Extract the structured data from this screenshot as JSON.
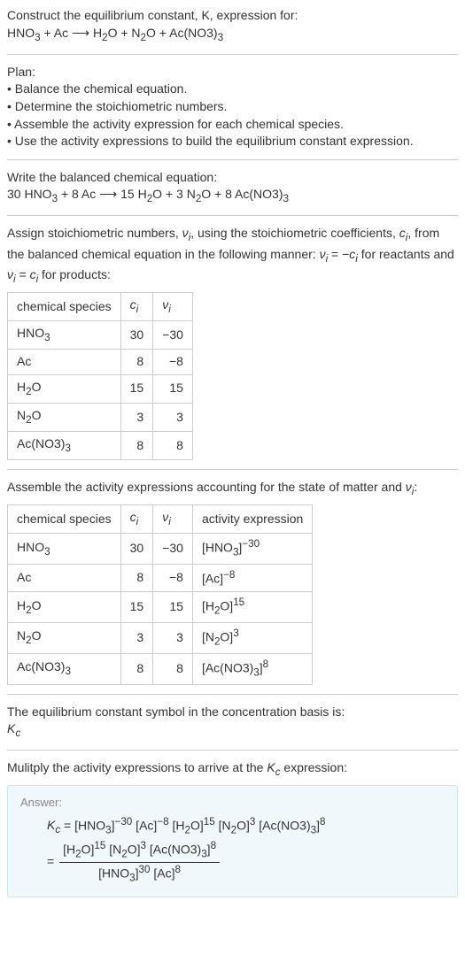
{
  "header": {
    "prompt_line1": "Construct the equilibrium constant, K, expression for:",
    "prompt_line2_html": "HNO<sub>3</sub> + Ac ⟶ H<sub>2</sub>O + N<sub>2</sub>O + Ac(NO3)<sub>3</sub>"
  },
  "plan": {
    "title": "Plan:",
    "items": [
      "• Balance the chemical equation.",
      "• Determine the stoichiometric numbers.",
      "• Assemble the activity expression for each chemical species.",
      "• Use the activity expressions to build the equilibrium constant expression."
    ]
  },
  "balanced": {
    "intro": "Write the balanced chemical equation:",
    "equation_html": "30 HNO<sub>3</sub> + 8 Ac ⟶ 15 H<sub>2</sub>O + 3 N<sub>2</sub>O + 8 Ac(NO3)<sub>3</sub>"
  },
  "stoich": {
    "intro_html": "Assign stoichiometric numbers, <i>ν<sub>i</sub></i>, using the stoichiometric coefficients, <i>c<sub>i</sub></i>, from the balanced chemical equation in the following manner: <i>ν<sub>i</sub></i> = −<i>c<sub>i</sub></i> for reactants and <i>ν<sub>i</sub></i> = <i>c<sub>i</sub></i> for products:",
    "headers": {
      "species": "chemical species",
      "c_html": "<i>c<sub>i</sub></i>",
      "nu_html": "<i>ν<sub>i</sub></i>"
    },
    "rows": [
      {
        "species_html": "HNO<sub>3</sub>",
        "c": "30",
        "nu": "−30"
      },
      {
        "species_html": "Ac",
        "c": "8",
        "nu": "−8"
      },
      {
        "species_html": "H<sub>2</sub>O",
        "c": "15",
        "nu": "15"
      },
      {
        "species_html": "N<sub>2</sub>O",
        "c": "3",
        "nu": "3"
      },
      {
        "species_html": "Ac(NO3)<sub>3</sub>",
        "c": "8",
        "nu": "8"
      }
    ]
  },
  "activity": {
    "intro_html": "Assemble the activity expressions accounting for the state of matter and <i>ν<sub>i</sub></i>:",
    "headers": {
      "species": "chemical species",
      "c_html": "<i>c<sub>i</sub></i>",
      "nu_html": "<i>ν<sub>i</sub></i>",
      "act": "activity expression"
    },
    "rows": [
      {
        "species_html": "HNO<sub>3</sub>",
        "c": "30",
        "nu": "−30",
        "act_html": "[HNO<sub>3</sub>]<sup>−30</sup>"
      },
      {
        "species_html": "Ac",
        "c": "8",
        "nu": "−8",
        "act_html": "[Ac]<sup>−8</sup>"
      },
      {
        "species_html": "H<sub>2</sub>O",
        "c": "15",
        "nu": "15",
        "act_html": "[H<sub>2</sub>O]<sup>15</sup>"
      },
      {
        "species_html": "N<sub>2</sub>O",
        "c": "3",
        "nu": "3",
        "act_html": "[N<sub>2</sub>O]<sup>3</sup>"
      },
      {
        "species_html": "Ac(NO3)<sub>3</sub>",
        "c": "8",
        "nu": "8",
        "act_html": "[Ac(NO3)<sub>3</sub>]<sup>8</sup>"
      }
    ]
  },
  "kc_symbol": {
    "intro": "The equilibrium constant symbol in the concentration basis is:",
    "symbol_html": "<i>K<sub>c</sub></i>"
  },
  "multiply": {
    "intro_html": "Mulitply the activity expressions to arrive at the <i>K<sub>c</sub></i> expression:"
  },
  "answer": {
    "label": "Answer:",
    "line1_html": "<i>K<sub>c</sub></i> = [HNO<sub>3</sub>]<sup>−30</sup> [Ac]<sup>−8</sup> [H<sub>2</sub>O]<sup>15</sup> [N<sub>2</sub>O]<sup>3</sup> [Ac(NO3)<sub>3</sub>]<sup>8</sup>",
    "frac_num_html": "[H<sub>2</sub>O]<sup>15</sup> [N<sub>2</sub>O]<sup>3</sup> [Ac(NO3)<sub>3</sub>]<sup>8</sup>",
    "frac_den_html": "[HNO<sub>3</sub>]<sup>30</sup> [Ac]<sup>8</sup>"
  }
}
